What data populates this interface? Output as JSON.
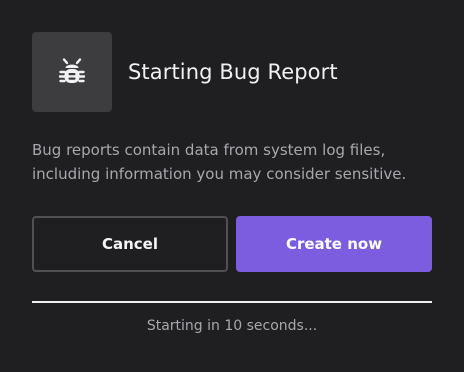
{
  "dialog": {
    "title": "Starting Bug Report",
    "icon": "bug-icon",
    "description": "Bug reports contain data from system log files, including information you may consider sensitive.",
    "buttons": {
      "cancel_label": "Cancel",
      "create_label": "Create now"
    },
    "status_text": "Starting in 10 seconds...",
    "progress_fraction": 1.0
  },
  "colors": {
    "background": "#1f1f21",
    "icon_tile": "#3d3d40",
    "accent": "#7b5ddf",
    "muted_text": "#a7a7ad"
  }
}
